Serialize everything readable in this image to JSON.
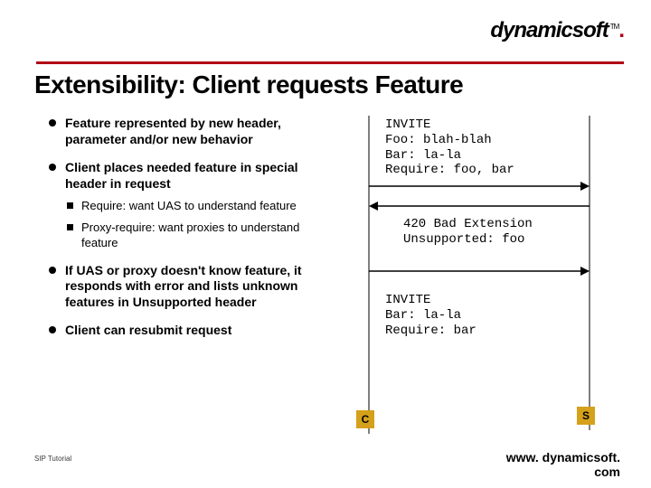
{
  "logo": {
    "text": "dynamicsoft",
    "tm": "TM"
  },
  "title": "Extensibility: Client requests Feature",
  "bullets": [
    {
      "text": "Feature represented by new header, parameter and/or new behavior"
    },
    {
      "text": "Client places needed feature in special header in request",
      "sub": [
        "Require: want UAS to  understand feature",
        "Proxy-require: want proxies to understand feature"
      ]
    },
    {
      "text": "If UAS or proxy doesn't know feature, it responds with error and lists unknown features in Unsupported header"
    },
    {
      "text": "Client can resubmit request"
    }
  ],
  "messages": {
    "msg1": "INVITE\nFoo: blah-blah\nBar: la-la\nRequire: foo, bar",
    "msg2": "420 Bad Extension\nUnsupported: foo",
    "msg3": "INVITE\nBar: la-la\nRequire: bar"
  },
  "endpoints": {
    "c": "C",
    "s": "S"
  },
  "footer": {
    "left": "SIP Tutorial",
    "right1": "www. dynamicsoft.",
    "right2": "com"
  }
}
